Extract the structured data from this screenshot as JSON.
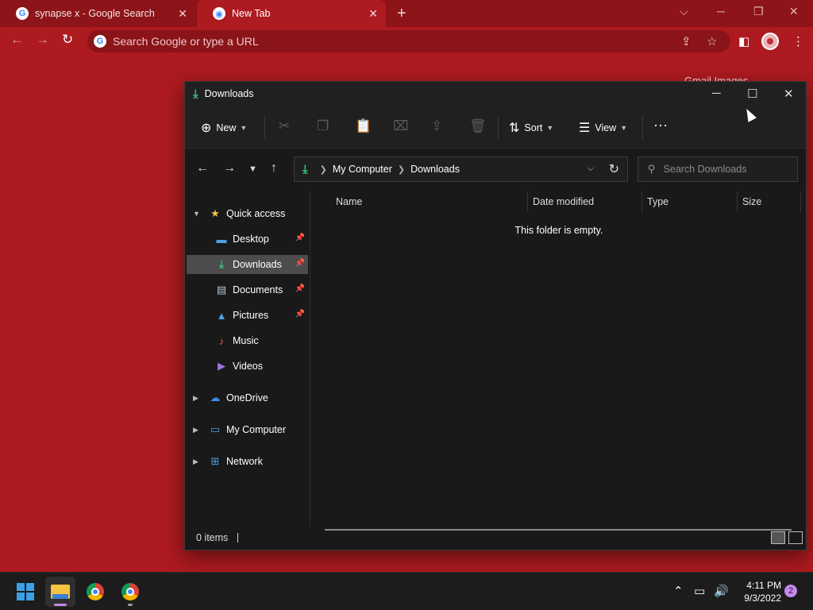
{
  "browser": {
    "tabs": [
      {
        "title": "synapse x - Google Search",
        "favicon": "google-icon"
      },
      {
        "title": "New Tab",
        "favicon": "chrome-icon"
      }
    ],
    "omnibox_placeholder": "Search Google or type a URL",
    "google_links": "Gmail   Images"
  },
  "explorer": {
    "title": "Downloads",
    "toolbar": {
      "new_label": "New",
      "sort_label": "Sort",
      "view_label": "View"
    },
    "address": {
      "root": "My Computer",
      "current": "Downloads"
    },
    "search_placeholder": "Search Downloads",
    "nav": {
      "quick_access": "Quick access",
      "items": [
        {
          "label": "Desktop",
          "pinned": true
        },
        {
          "label": "Downloads",
          "pinned": true,
          "selected": true
        },
        {
          "label": "Documents",
          "pinned": true
        },
        {
          "label": "Pictures",
          "pinned": true
        },
        {
          "label": "Music",
          "pinned": false
        },
        {
          "label": "Videos",
          "pinned": false
        }
      ],
      "onedrive": "OneDrive",
      "my_computer": "My Computer",
      "network": "Network"
    },
    "columns": {
      "name": "Name",
      "date": "Date modified",
      "type": "Type",
      "size": "Size"
    },
    "empty_message": "This folder is empty.",
    "status": "0 items"
  },
  "taskbar": {
    "time": "4:11 PM",
    "date": "9/3/2022",
    "notifications": "2"
  },
  "colors": {
    "desktop_bg": "#ad1a1f",
    "explorer_bg": "#191919",
    "accent": "#35c27a"
  }
}
